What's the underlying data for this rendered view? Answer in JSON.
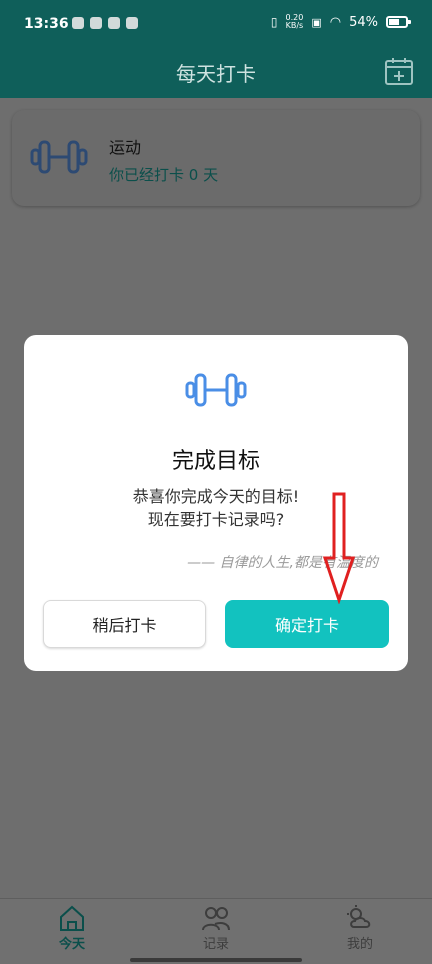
{
  "status_bar": {
    "time": "13:36",
    "net_speed_value": "0.20",
    "net_speed_unit": "KB/s",
    "battery": "54%"
  },
  "header": {
    "title": "每天打卡",
    "add_icon": "calendar-add-icon"
  },
  "habit_card": {
    "icon": "dumbbell-icon",
    "name": "运动",
    "status": "你已经打卡 0 天"
  },
  "dialog": {
    "icon": "dumbbell-icon",
    "title": "完成目标",
    "message_line1": "恭喜你完成今天的目标!",
    "message_line2": "现在要打卡记录吗?",
    "quote": "—— 自律的人生,都是有温度的",
    "later_button": "稍后打卡",
    "confirm_button": "确定打卡"
  },
  "bottom_nav": {
    "items": [
      {
        "label": "今天",
        "icon": "home-icon",
        "active": true
      },
      {
        "label": "记录",
        "icon": "people-icon",
        "active": false
      },
      {
        "label": "我的",
        "icon": "weather-icon",
        "active": false
      }
    ]
  },
  "colors": {
    "teal": "#12c2bf",
    "header_teal_dimmed": "#0f5f5a",
    "annotation_red": "#e02020"
  }
}
